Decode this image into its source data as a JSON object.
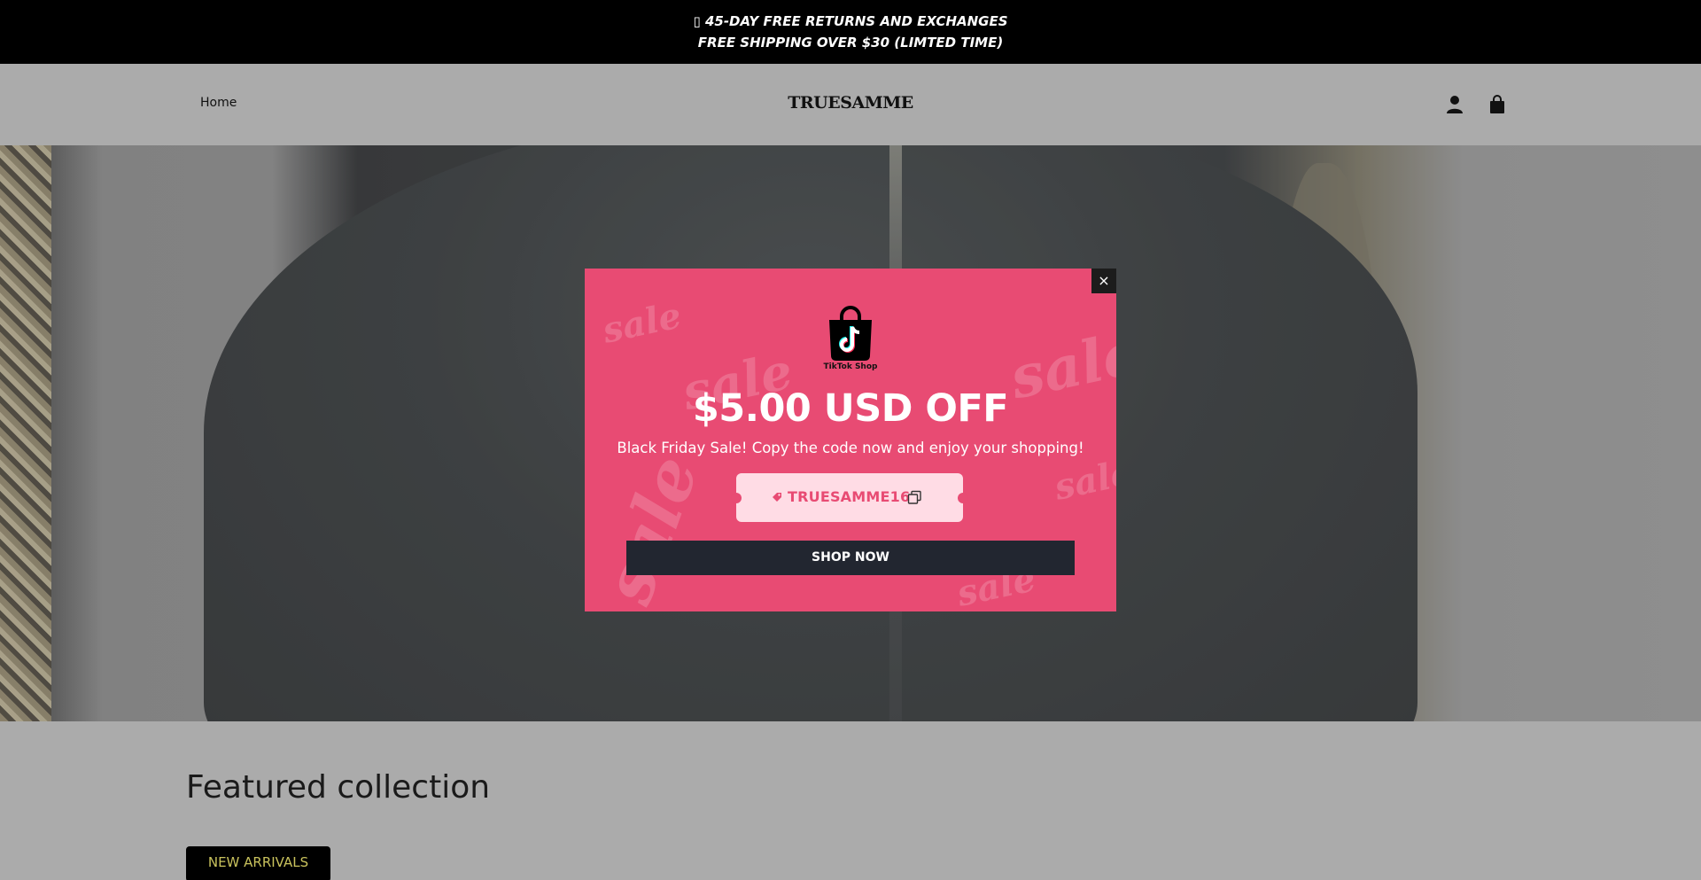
{
  "announcement": {
    "line1": "▯ 45-DAY FREE RETURNS AND EXCHANGES",
    "line2": "FREE SHIPPING OVER $30 (LIMTED TIME)"
  },
  "header": {
    "nav_home": "Home",
    "logo": "TRUESAMME",
    "account_icon": "account-icon",
    "cart_icon": "shopping-bag-icon"
  },
  "featured": {
    "title": "Featured collection",
    "button": "NEW ARRIVALS"
  },
  "popup": {
    "close": "×",
    "logo_label": "TikTok Shop",
    "discount": "$5.00 USD OFF",
    "subtitle": "Black Friday Sale! Copy the code now and enjoy your shopping!",
    "code": "TRUESAMME16",
    "cta": "SHOP NOW",
    "watermark": "sale",
    "background_color": "#e84b73",
    "button_color": "#222630"
  }
}
